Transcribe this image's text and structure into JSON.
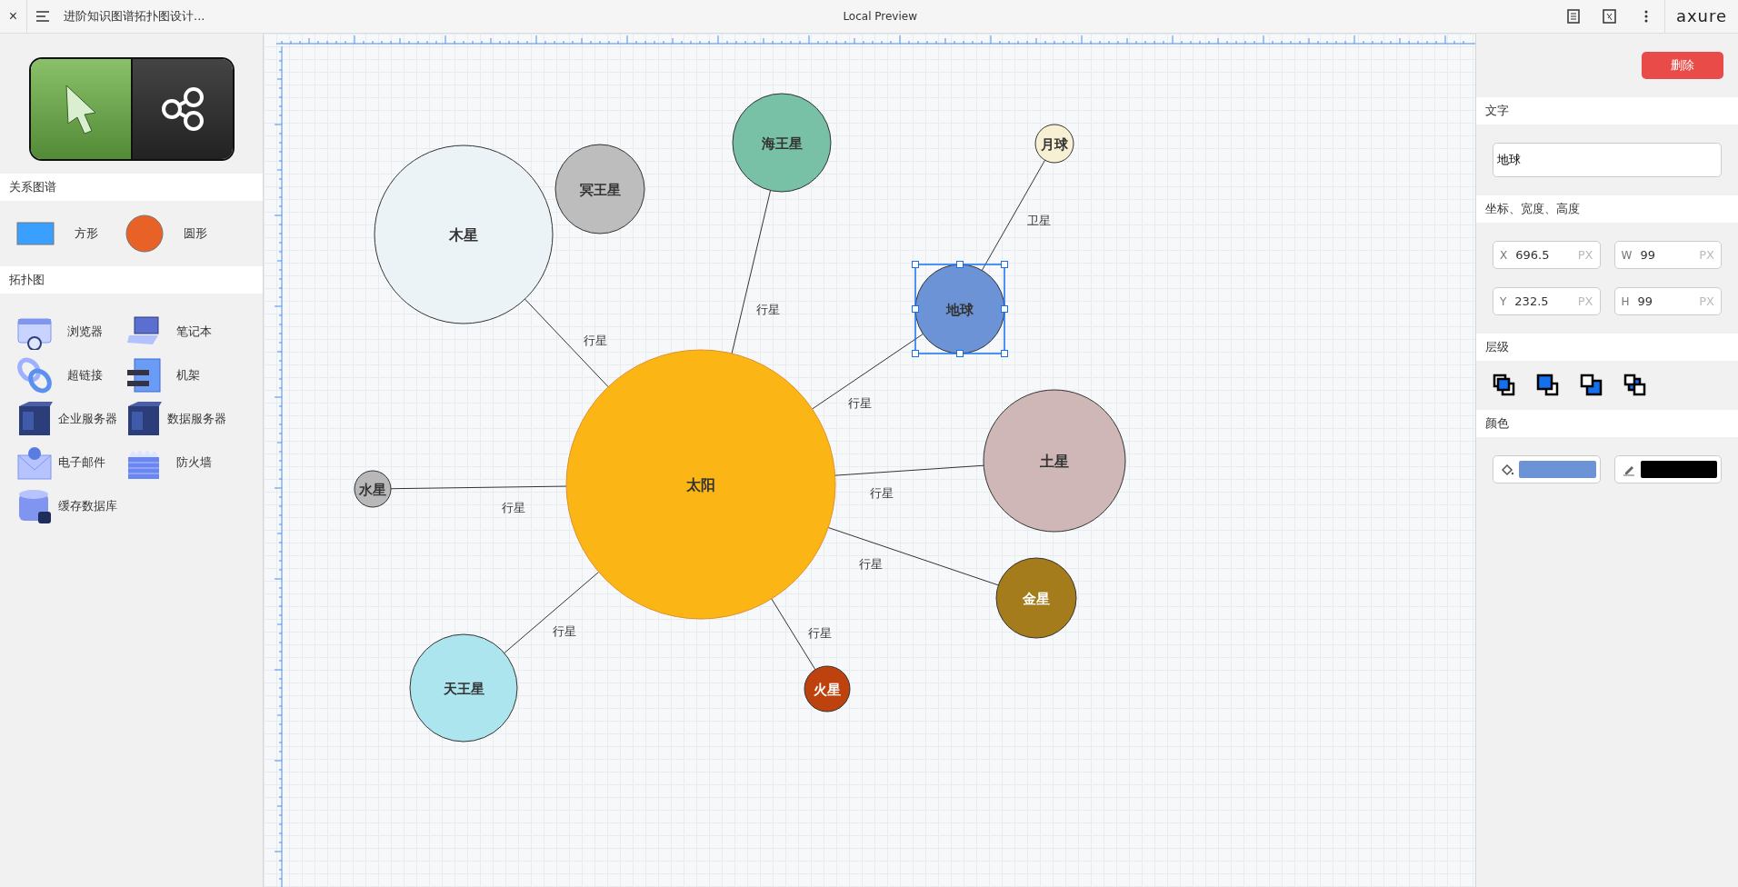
{
  "topbar": {
    "close": "×",
    "title": "进阶知识图谱拓扑图设计...",
    "center_title": "Local Preview",
    "brand": "axure"
  },
  "left_panel": {
    "mode_toggle": [
      {
        "kind": "select",
        "selected": true
      },
      {
        "kind": "connect",
        "selected": false
      }
    ],
    "sections": [
      {
        "title": "关系图谱",
        "items": [
          {
            "kind": "rect",
            "label": "方形"
          },
          {
            "kind": "circle",
            "label": "圆形"
          }
        ]
      },
      {
        "title": "拓扑图",
        "items": [
          {
            "kind": "browser",
            "label": "浏览器"
          },
          {
            "kind": "laptop",
            "label": "笔记本"
          },
          {
            "kind": "link",
            "label": "超链接"
          },
          {
            "kind": "rack",
            "label": "机架"
          },
          {
            "kind": "server",
            "label": "企业服务器"
          },
          {
            "kind": "server",
            "label": "数据服务器"
          },
          {
            "kind": "mail",
            "label": "电子邮件"
          },
          {
            "kind": "firewall",
            "label": "防火墙"
          },
          {
            "kind": "database",
            "label": "缓存数据库"
          }
        ]
      }
    ]
  },
  "canvas": {
    "nodes": [
      {
        "label": "太阳",
        "color": "#fbb615",
        "selected": false
      },
      {
        "label": "木星",
        "color": "#ecf3f6",
        "selected": false
      },
      {
        "label": "冥王星",
        "color": "#bdbdbd",
        "selected": false
      },
      {
        "label": "海王星",
        "color": "#78c1a7",
        "selected": false
      },
      {
        "label": "月球",
        "color": "#f7f0d2",
        "selected": false
      },
      {
        "label": "地球",
        "color": "#6b93d6",
        "selected": true
      },
      {
        "label": "土星",
        "color": "#ceb7b6",
        "selected": false
      },
      {
        "label": "金星",
        "color": "#a57c1c",
        "selected": false
      },
      {
        "label": "火星",
        "color": "#be420e",
        "selected": false
      },
      {
        "label": "天王星",
        "color": "#ade5ee",
        "selected": false
      },
      {
        "label": "水星",
        "color": "#b8b8b8",
        "selected": false
      }
    ],
    "edges": [
      {
        "label": "行星"
      },
      {
        "label": "行星"
      },
      {
        "label": "行星"
      },
      {
        "label": "行星"
      },
      {
        "label": "行星"
      },
      {
        "label": "行星"
      },
      {
        "label": "行星"
      },
      {
        "label": "行星"
      },
      {
        "label": "卫星"
      }
    ]
  },
  "right_panel": {
    "delete_button": "删除",
    "text_section": {
      "title": "文字",
      "value": "地球"
    },
    "geometry_section": {
      "title": "坐标、宽度、高度",
      "fields": [
        {
          "axis": "X",
          "value": "696.5",
          "unit": "PX"
        },
        {
          "axis": "W",
          "value": "99",
          "unit": "PX"
        },
        {
          "axis": "Y",
          "value": "232.5",
          "unit": "PX"
        },
        {
          "axis": "H",
          "value": "99",
          "unit": "PX"
        }
      ]
    },
    "layer_section": {
      "title": "层级",
      "buttons": [
        {
          "kind": "front"
        },
        {
          "kind": "forward"
        },
        {
          "kind": "backward"
        },
        {
          "kind": "back"
        }
      ]
    },
    "color_section": {
      "title": "颜色",
      "swatches": [
        {
          "kind": "fill",
          "color": "#6b93d6"
        },
        {
          "kind": "stroke",
          "color": "#000000"
        }
      ]
    }
  }
}
